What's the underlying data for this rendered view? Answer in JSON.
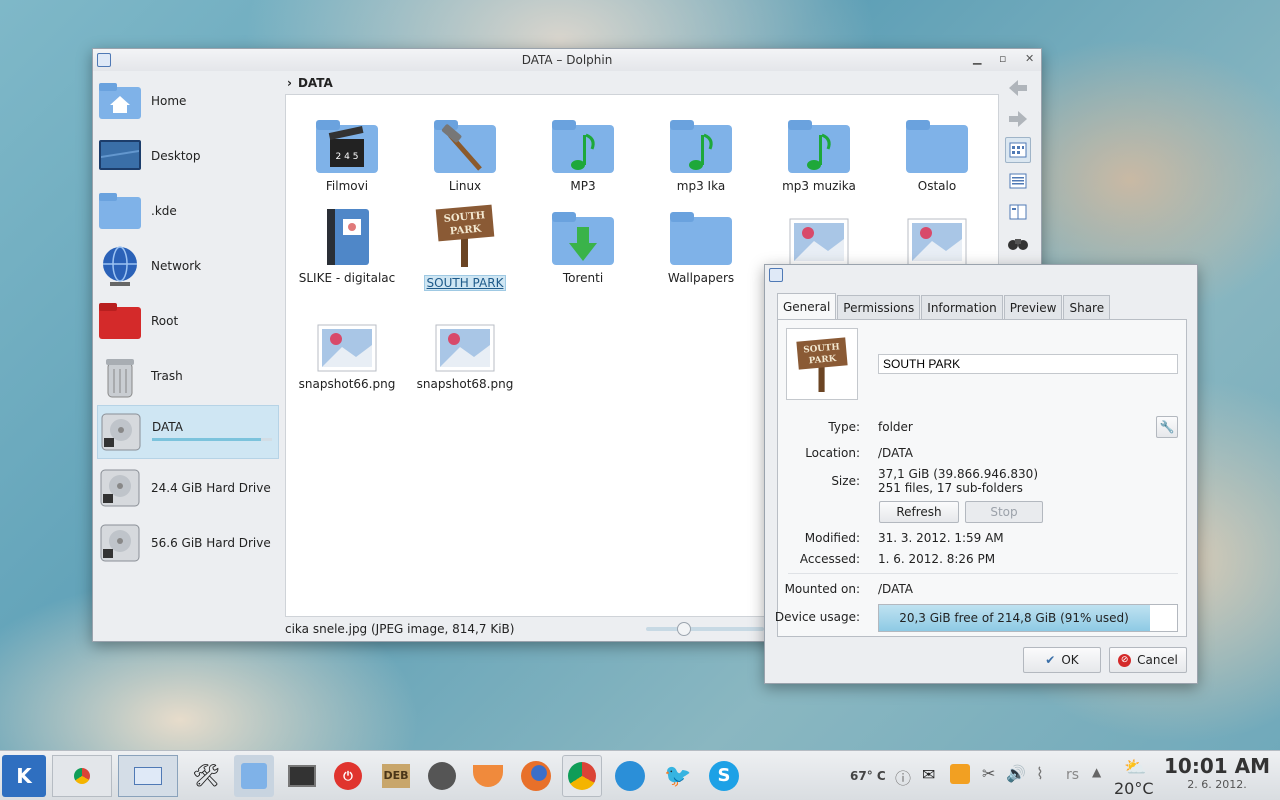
{
  "window": {
    "title": "DATA – Dolphin",
    "minimize": "▫",
    "maximize": "▫",
    "close": "✕"
  },
  "places": [
    {
      "label": "Home",
      "icon": "home-folder-icon"
    },
    {
      "label": "Desktop",
      "icon": "desktop-icon"
    },
    {
      "label": ".kde",
      "icon": "folder-icon"
    },
    {
      "label": "Network",
      "icon": "network-globe-icon"
    },
    {
      "label": "Root",
      "icon": "red-folder-icon"
    },
    {
      "label": "Trash",
      "icon": "trash-icon"
    },
    {
      "label": "DATA",
      "icon": "hard-drive-icon",
      "selected": true,
      "usage": 0.91
    },
    {
      "label": "24.4 GiB Hard Drive",
      "icon": "hard-drive-icon"
    },
    {
      "label": "56.6 GiB Hard Drive",
      "icon": "hard-drive-icon"
    }
  ],
  "breadcrumb": {
    "arrow": "›",
    "path": "DATA"
  },
  "files": [
    {
      "name": "Filmovi",
      "icon": "film-folder-icon"
    },
    {
      "name": "Linux",
      "icon": "tools-folder-icon"
    },
    {
      "name": "MP3",
      "icon": "music-folder-icon"
    },
    {
      "name": "mp3 Ika",
      "icon": "music-folder-icon"
    },
    {
      "name": "mp3 muzika",
      "icon": "music-folder-icon"
    },
    {
      "name": "Ostalo",
      "icon": "folder-icon"
    },
    {
      "name": "SLIKE - digitalac",
      "icon": "photo-book-icon"
    },
    {
      "name": "SOUTH PARK",
      "icon": "south-park-sign-icon",
      "selected": true
    },
    {
      "name": "Torenti",
      "icon": "download-folder-icon"
    },
    {
      "name": "Wallpapers",
      "icon": "folder-icon"
    },
    {
      "name": "",
      "icon": "image-file-icon"
    },
    {
      "name": "",
      "icon": "image-file-icon"
    },
    {
      "name": "snapshot66.png",
      "icon": "image-file-icon"
    },
    {
      "name": "snapshot68.png",
      "icon": "image-file-icon"
    }
  ],
  "statusbar": {
    "text": "cika snele.jpg (JPEG image, 814,7 KiB)",
    "zoom_level": 0.3
  },
  "dialog": {
    "tabs": [
      "General",
      "Permissions",
      "Information",
      "Preview",
      "Share"
    ],
    "name": "SOUTH PARK",
    "sign_text": "SOUTH PARK",
    "labels": {
      "type": "Type:",
      "location": "Location:",
      "size": "Size:",
      "modified": "Modified:",
      "accessed": "Accessed:",
      "mounted": "Mounted on:",
      "usage": "Device usage:"
    },
    "values": {
      "type": "folder",
      "location": "/DATA",
      "size_line1": "37,1 GiB (39.866.946.830)",
      "size_line2": "251 files, 17 sub-folders",
      "modified": "31. 3. 2012. 1:59 AM",
      "accessed": "1. 6. 2012. 8:26 PM",
      "mounted": "/DATA",
      "usage": "20,3 GiB free of 214,8 GiB (91% used)"
    },
    "usage_fraction": 0.91,
    "buttons": {
      "refresh": "Refresh",
      "stop": "Stop",
      "ok": "OK",
      "cancel": "Cancel"
    }
  },
  "taskbar": {
    "weather_temp": "67° C",
    "tray_text": "rs",
    "outdoor_temp": "20°C",
    "time": "10:01 AM",
    "date": "2. 6. 2012.",
    "deb_label": "DEB"
  },
  "colors": {
    "accent": "#7cc3dc",
    "folder": "#7fb2e8",
    "selection": "#cfe6f3"
  }
}
